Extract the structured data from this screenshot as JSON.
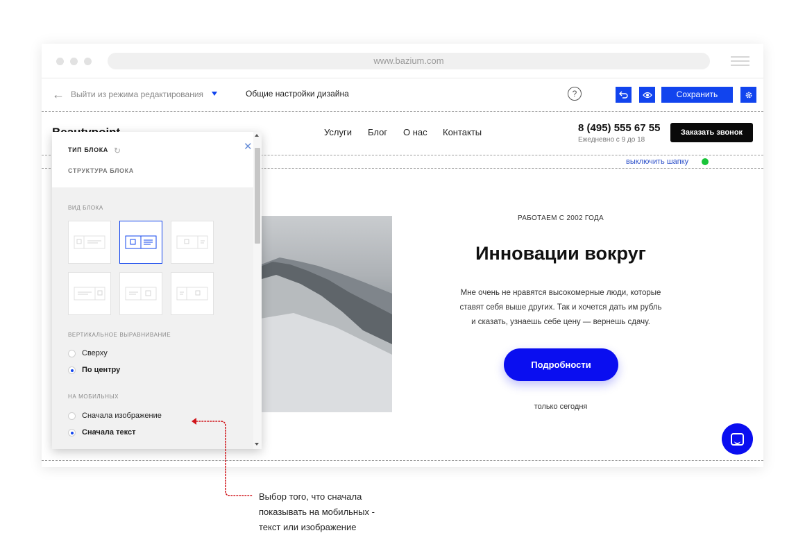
{
  "browser": {
    "url": "www.bazium.com"
  },
  "toolbar": {
    "exit_label": "Выйти из режима редактирования",
    "design_label": "Общие настройки дизайна",
    "help_label": "?",
    "save_label": "Сохранить"
  },
  "site_header": {
    "logo": "Beautypoint",
    "nav": [
      "Услуги",
      "Блог",
      "О нас",
      "Контакты"
    ],
    "phone": "8 (495) 555 67 55",
    "hours": "Ежедневно с 9 до 18",
    "call_button": "Заказать звонок",
    "toggle_label": "выключить шапку"
  },
  "content": {
    "tagline": "РАБОТАЕМ С 2002 ГОДА",
    "headline": "Инновации вокруг",
    "body_lines": [
      "Мне очень не нравятся высокомерные люди, которые",
      "ставят себя выше других. Так и хочется дать им рубль",
      "и сказать, узнаешь себе цену — вернешь сдачу."
    ],
    "button": "Подробности",
    "note": "только сегодня"
  },
  "panel": {
    "title": "ТИП БЛОКА",
    "subtitle": "СТРУКТУРА БЛОКА",
    "view_label": "ВИД БЛОКА",
    "align_label": "ВЕРТИКАЛЬНОЕ ВЫРАВНИВАНИЕ",
    "align_options": [
      "Сверху",
      "По центру"
    ],
    "align_selected": "По центру",
    "mobile_label": "НА МОБИЛЬНЫХ",
    "mobile_options": [
      "Сначала изображение",
      "Сначала текст"
    ],
    "mobile_selected": "Сначала текст",
    "layouts_selected": 1
  },
  "annotation": {
    "lines": [
      "Выбор того, что сначала",
      "показывать на мобильных -",
      "текст или изображение"
    ]
  },
  "colors": {
    "accent": "#1144ee",
    "button_blue": "#0a0ef0",
    "status_green": "#19c439",
    "annotation_red": "#d0141a"
  }
}
